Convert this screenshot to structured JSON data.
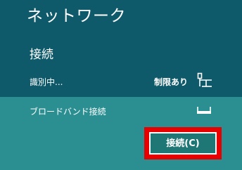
{
  "panel": {
    "title": "ネットワーク"
  },
  "connections": {
    "heading": "接続",
    "items": [
      {
        "name": "識別中...",
        "status": "制限あり",
        "icon": "wired-network-icon"
      },
      {
        "name": "ブロードバンド接続",
        "icon": "broadband-modem-icon",
        "connect_label": "接続(C)"
      }
    ]
  },
  "colors": {
    "background": "#0f5a6a",
    "selected_row": "#2b8f91",
    "highlight": "#e60000",
    "button_fill": "#1e7775"
  }
}
